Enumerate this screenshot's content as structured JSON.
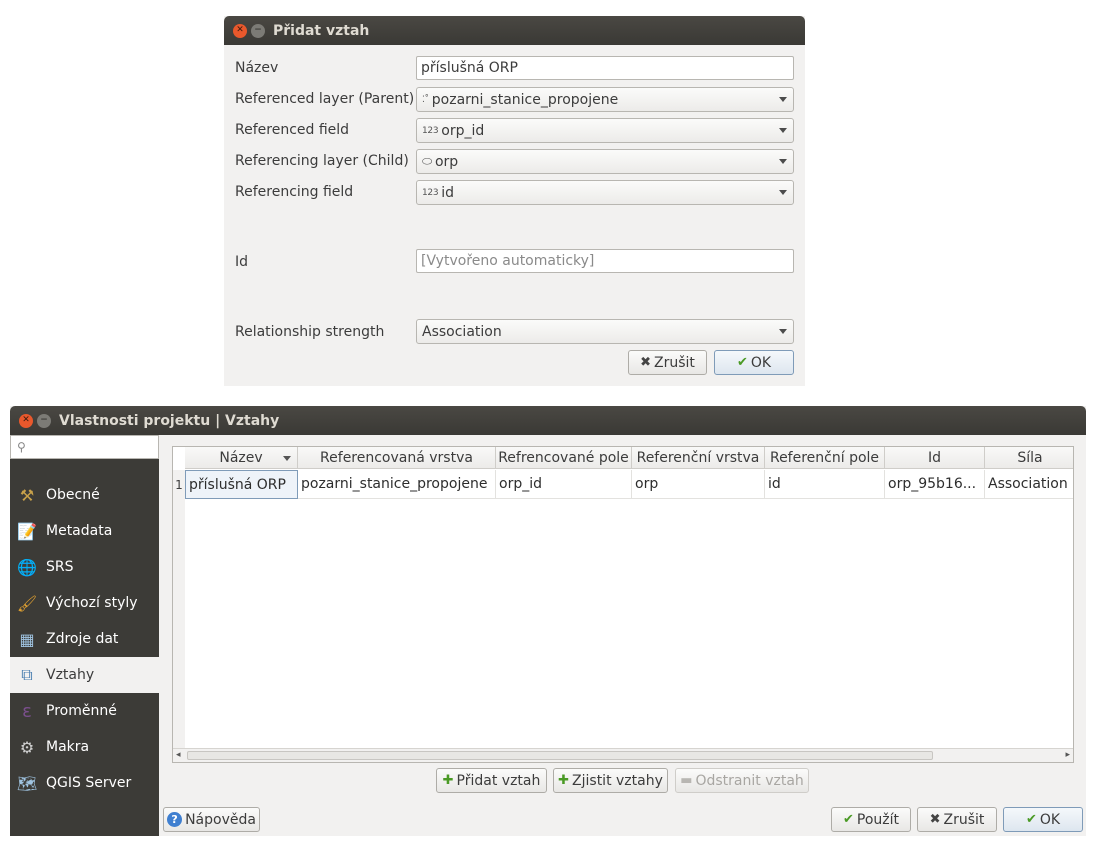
{
  "dialog_add_relation": {
    "title": "Přidat vztah",
    "labels": {
      "name": "Název",
      "referenced_layer": "Referenced layer (Parent)",
      "referenced_field": "Referenced field",
      "referencing_layer": "Referencing layer (Child)",
      "referencing_field": "Referencing field",
      "id": "Id",
      "strength": "Relationship strength"
    },
    "values": {
      "name": "příslušná ORP",
      "referenced_layer": "pozarni_stanice_propojene",
      "referenced_field": "orp_id",
      "referencing_layer": "orp",
      "referencing_field": "id",
      "id_placeholder": "[Vytvořeno automaticky]",
      "strength": "Association"
    },
    "field_type_badge": "123",
    "buttons": {
      "cancel": "Zrušit",
      "ok": "OK"
    }
  },
  "project_properties": {
    "title": "Vlastnosti projektu | Vztahy",
    "sidebar": {
      "items": [
        {
          "label": "Obecné",
          "icon": "tools-icon"
        },
        {
          "label": "Metadata",
          "icon": "metadata-icon"
        },
        {
          "label": "SRS",
          "icon": "globe-icon"
        },
        {
          "label": "Výchozí styly",
          "icon": "paintbrush-icon"
        },
        {
          "label": "Zdroje dat",
          "icon": "table-icon"
        },
        {
          "label": "Vztahy",
          "icon": "relations-icon",
          "active": true
        },
        {
          "label": "Proměnné",
          "icon": "epsilon-icon"
        },
        {
          "label": "Makra",
          "icon": "gear-icon"
        },
        {
          "label": "QGIS Server",
          "icon": "server-icon"
        }
      ]
    },
    "table": {
      "columns": [
        "Název",
        "Referencovaná vrstva",
        "Refrencované pole",
        "Referenční vrstva",
        "Referenční pole",
        "Id",
        "Síla"
      ],
      "rows": [
        {
          "num": "1",
          "cells": [
            "příslušná ORP",
            "pozarni_stanice_propojene",
            "orp_id",
            "orp",
            "id",
            "orp_95b16...",
            "Association"
          ]
        }
      ]
    },
    "actions": {
      "add": "Přidat vztah",
      "discover": "Zjistit vztahy",
      "remove": "Odstranit vztah"
    },
    "footer": {
      "help": "Nápověda",
      "apply": "Použít",
      "cancel": "Zrušit",
      "ok": "OK"
    }
  }
}
